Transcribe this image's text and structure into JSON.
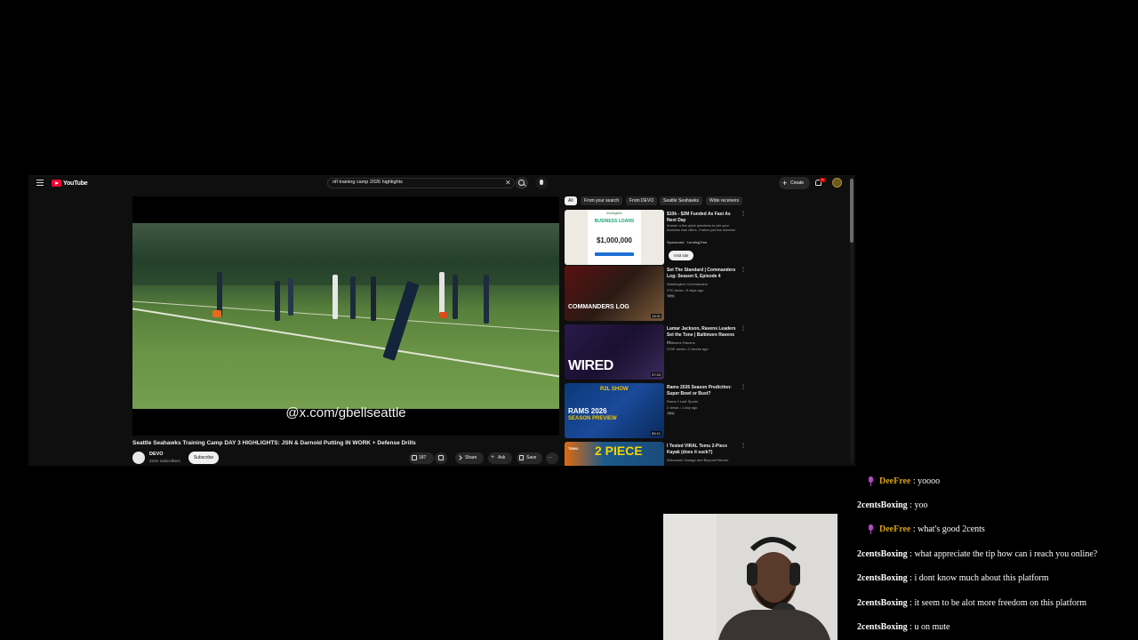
{
  "youtube": {
    "logo_text": "YouTube",
    "search_query": "nfl training camp 2026 highlights",
    "clear_glyph": "✕",
    "create_label": "Create",
    "notification_count": "9+",
    "video": {
      "overlay_text": "@x.com/gbellseattle",
      "title": "Seattle Seahawks Training Camp DAY 3 HIGHLIGHTS: JSN & Darnold Putting IN WORK + Defense Drills",
      "channel": "DEVO",
      "subscribers": "224K subscribers",
      "subscribe_label": "Subscribe",
      "likes": "187",
      "share_label": "Share",
      "ask_label": "Ask",
      "save_label": "Save",
      "more_glyph": "···"
    },
    "chips": [
      "All",
      "From your search",
      "From DEVO",
      "Seattle Seahawks",
      "Wide receivers"
    ],
    "recommendations": [
      {
        "title": "$10k - $2M Funded As Fast As Next Day",
        "channel": "Answer a few quick questions to see your business loan offers. It takes just two minutes!",
        "meta": "Sponsored · LendingTree",
        "cta": "Visit site",
        "thumb_brand": "lendingtree",
        "thumb_heading": "BUSINESS LOANS",
        "thumb_amount": "$1,000,000"
      },
      {
        "title": "Set The Standard | Commanders Log: Season 5, Episode 4",
        "channel": "Washington Commanders",
        "meta": "27K views • 5 days ago",
        "badge": "New",
        "duration": "13:31",
        "thumb_text": "COMMANDERS LOG"
      },
      {
        "title": "Lamar Jackson, Ravens Leaders Set the Tone | Baltimore Ravens ...",
        "channel": "Baltimore Ravens",
        "meta": "219K views • 2 weeks ago",
        "duration": "37:20",
        "thumb_text": "WIRED"
      },
      {
        "title": "Rams 2026 Season Prediction: Super Bowl or Bust?",
        "channel": "Rams 2 Last Sports",
        "meta": "2 views • 1 day ago",
        "badge": "New",
        "duration": "55:21",
        "thumb_text": "RAMS 2026",
        "thumb_sub": "SEASON PREVIEW",
        "thumb_show": "R2L SHOW"
      },
      {
        "title": "I Tested VIRAL Temu 2-Piece Kayak (does it suck?)",
        "channel": "Wisconsin Garage and Beyond Reborn",
        "thumb_text": "2 PIECE",
        "thumb_brand": "TEMU"
      }
    ]
  },
  "chat": [
    {
      "user": "DeeFree",
      "message": ": yoooo",
      "highlight": true
    },
    {
      "user": "2centsBoxing",
      "message": ": yoo",
      "highlight": false
    },
    {
      "user": "DeeFree",
      "message": ": what's good 2cents",
      "highlight": true
    },
    {
      "user": "2centsBoxing",
      "message": ": what appreciate the tip how can i reach you online?",
      "highlight": false
    },
    {
      "user": "2centsBoxing",
      "message": ": i dont know much about this platform",
      "highlight": false
    },
    {
      "user": "2centsBoxing",
      "message": ": it seem to be alot more freedom on this platform",
      "highlight": false
    },
    {
      "user": "2centsBoxing",
      "message": ": u on mute",
      "highlight": false
    }
  ],
  "colors": {
    "youtube_bg": "#0f0f0f",
    "youtube_red": "#ff0033",
    "chat_highlight_user": "#d4a017",
    "chat_mic": "#b648c8"
  },
  "icons": [
    "menu-icon",
    "youtube-logo-icon",
    "search-icon",
    "mic-icon",
    "plus-icon",
    "bell-icon",
    "like-icon",
    "dislike-icon",
    "share-icon",
    "ask-icon",
    "save-icon",
    "more-icon",
    "mic-chat-icon"
  ]
}
